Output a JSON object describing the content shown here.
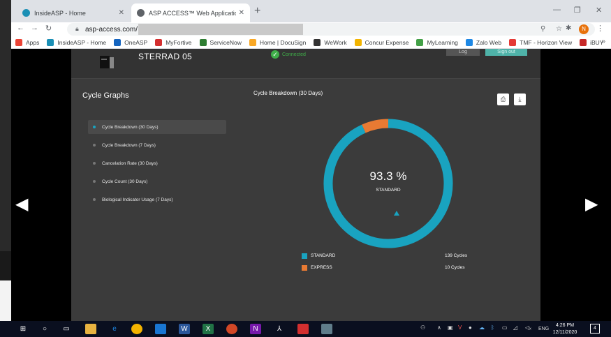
{
  "browser": {
    "tabs": [
      {
        "title": "InsideASP - Home",
        "active": false
      },
      {
        "title": "ASP ACCESS™ Web Application",
        "active": true
      }
    ],
    "new_tab": "+",
    "url": "asp-access.com/",
    "profile_initial": "N",
    "bookmarks": [
      {
        "label": "Apps",
        "color": "#ea4335"
      },
      {
        "label": "InsideASP - Home",
        "color": "#1a8fb5"
      },
      {
        "label": "OneASP",
        "color": "#1565c0"
      },
      {
        "label": "MyFortive",
        "color": "#d32f2f"
      },
      {
        "label": "ServiceNow",
        "color": "#2e7d32"
      },
      {
        "label": "Home | DocuSign",
        "color": "#f9a825"
      },
      {
        "label": "WeWork",
        "color": "#333333"
      },
      {
        "label": "Concur Expense",
        "color": "#f2b400"
      },
      {
        "label": "MyLearning",
        "color": "#43a047"
      },
      {
        "label": "Zalo Web",
        "color": "#1e88e5"
      },
      {
        "label": "TMF - Horizon View",
        "color": "#e53935"
      },
      {
        "label": "iBUY",
        "color": "#c62828"
      }
    ],
    "bookmarks_more": "»"
  },
  "app": {
    "device_name": "STERRAD 05",
    "status": "Connected",
    "log_button": "Log",
    "signout_button": "Sign out"
  },
  "panel": {
    "title": "Cycle Graphs",
    "menu": [
      {
        "label": "Cycle Breakdown (30 Days)",
        "selected": true
      },
      {
        "label": "Cycle Breakdown (7 Days)",
        "selected": false
      },
      {
        "label": "Cancelation Rate (30 Days)",
        "selected": false
      },
      {
        "label": "Cycle Count (30 Days)",
        "selected": false
      },
      {
        "label": "Biological Indicator Usage (7 Days)",
        "selected": false
      }
    ],
    "chart_title": "Cycle Breakdown (30 Days)",
    "center_value": "93.3 %",
    "center_label": "STANDARD",
    "legend": [
      {
        "name": "STANDARD",
        "value": "139 Cycles",
        "color": "#19a3c0"
      },
      {
        "name": "EXPRESS",
        "value": "10 Cycles",
        "color": "#e87a33"
      }
    ]
  },
  "chart_data": {
    "type": "pie",
    "title": "Cycle Breakdown (30 Days)",
    "categories": [
      "STANDARD",
      "EXPRESS"
    ],
    "values": [
      139,
      10
    ],
    "colors": [
      "#19a3c0",
      "#e87a33"
    ],
    "center_label": "93.3 %"
  },
  "taskbar": {
    "keyboard": "ENG",
    "time": "4:26 PM",
    "date": "12/11/2020",
    "notifications": "4"
  }
}
